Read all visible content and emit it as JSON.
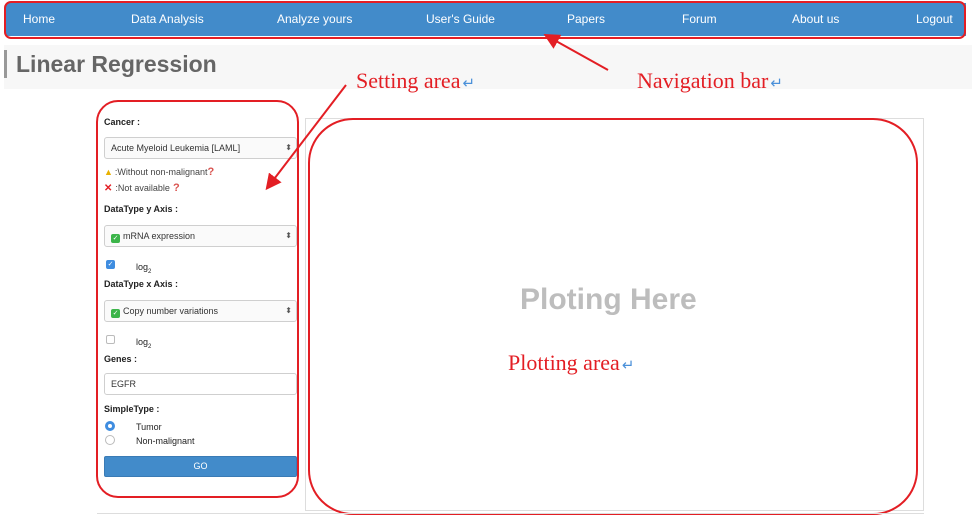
{
  "nav": {
    "items": [
      "Home",
      "Data Analysis",
      "Analyze yours",
      "User's Guide",
      "Papers",
      "Forum",
      "About us",
      "Logout"
    ]
  },
  "page": {
    "title": "Linear Regression"
  },
  "annotations": {
    "setting_area": "Setting area",
    "navigation_bar": "Navigation bar",
    "plotting_area": "Plotting area",
    "return_mark": "↵"
  },
  "settings": {
    "cancer_label": "Cancer :",
    "cancer_value": "Acute Myeloid Leukemia [LAML]",
    "legend_without": ":Without non-malignant",
    "legend_not_available": ":Not available",
    "y_axis_label": "DataType y Axis :",
    "y_axis_value": "mRNA expression",
    "y_log_checked": true,
    "log_label": "log",
    "log_sub": "2",
    "x_axis_label": "DataType x Axis :",
    "x_axis_value": "Copy number variations",
    "x_log_checked": false,
    "genes_label": "Genes :",
    "genes_value": "EGFR",
    "sample_type_label": "SimpleType :",
    "sample_types": [
      "Tumor",
      "Non-malignant"
    ],
    "sample_type_selected": "Tumor",
    "go_label": "GO"
  },
  "plot": {
    "placeholder": "Ploting Here"
  },
  "colors": {
    "nav_bg": "#428bca",
    "annotation": "#e31e24",
    "check_green": "#3cb54a"
  }
}
